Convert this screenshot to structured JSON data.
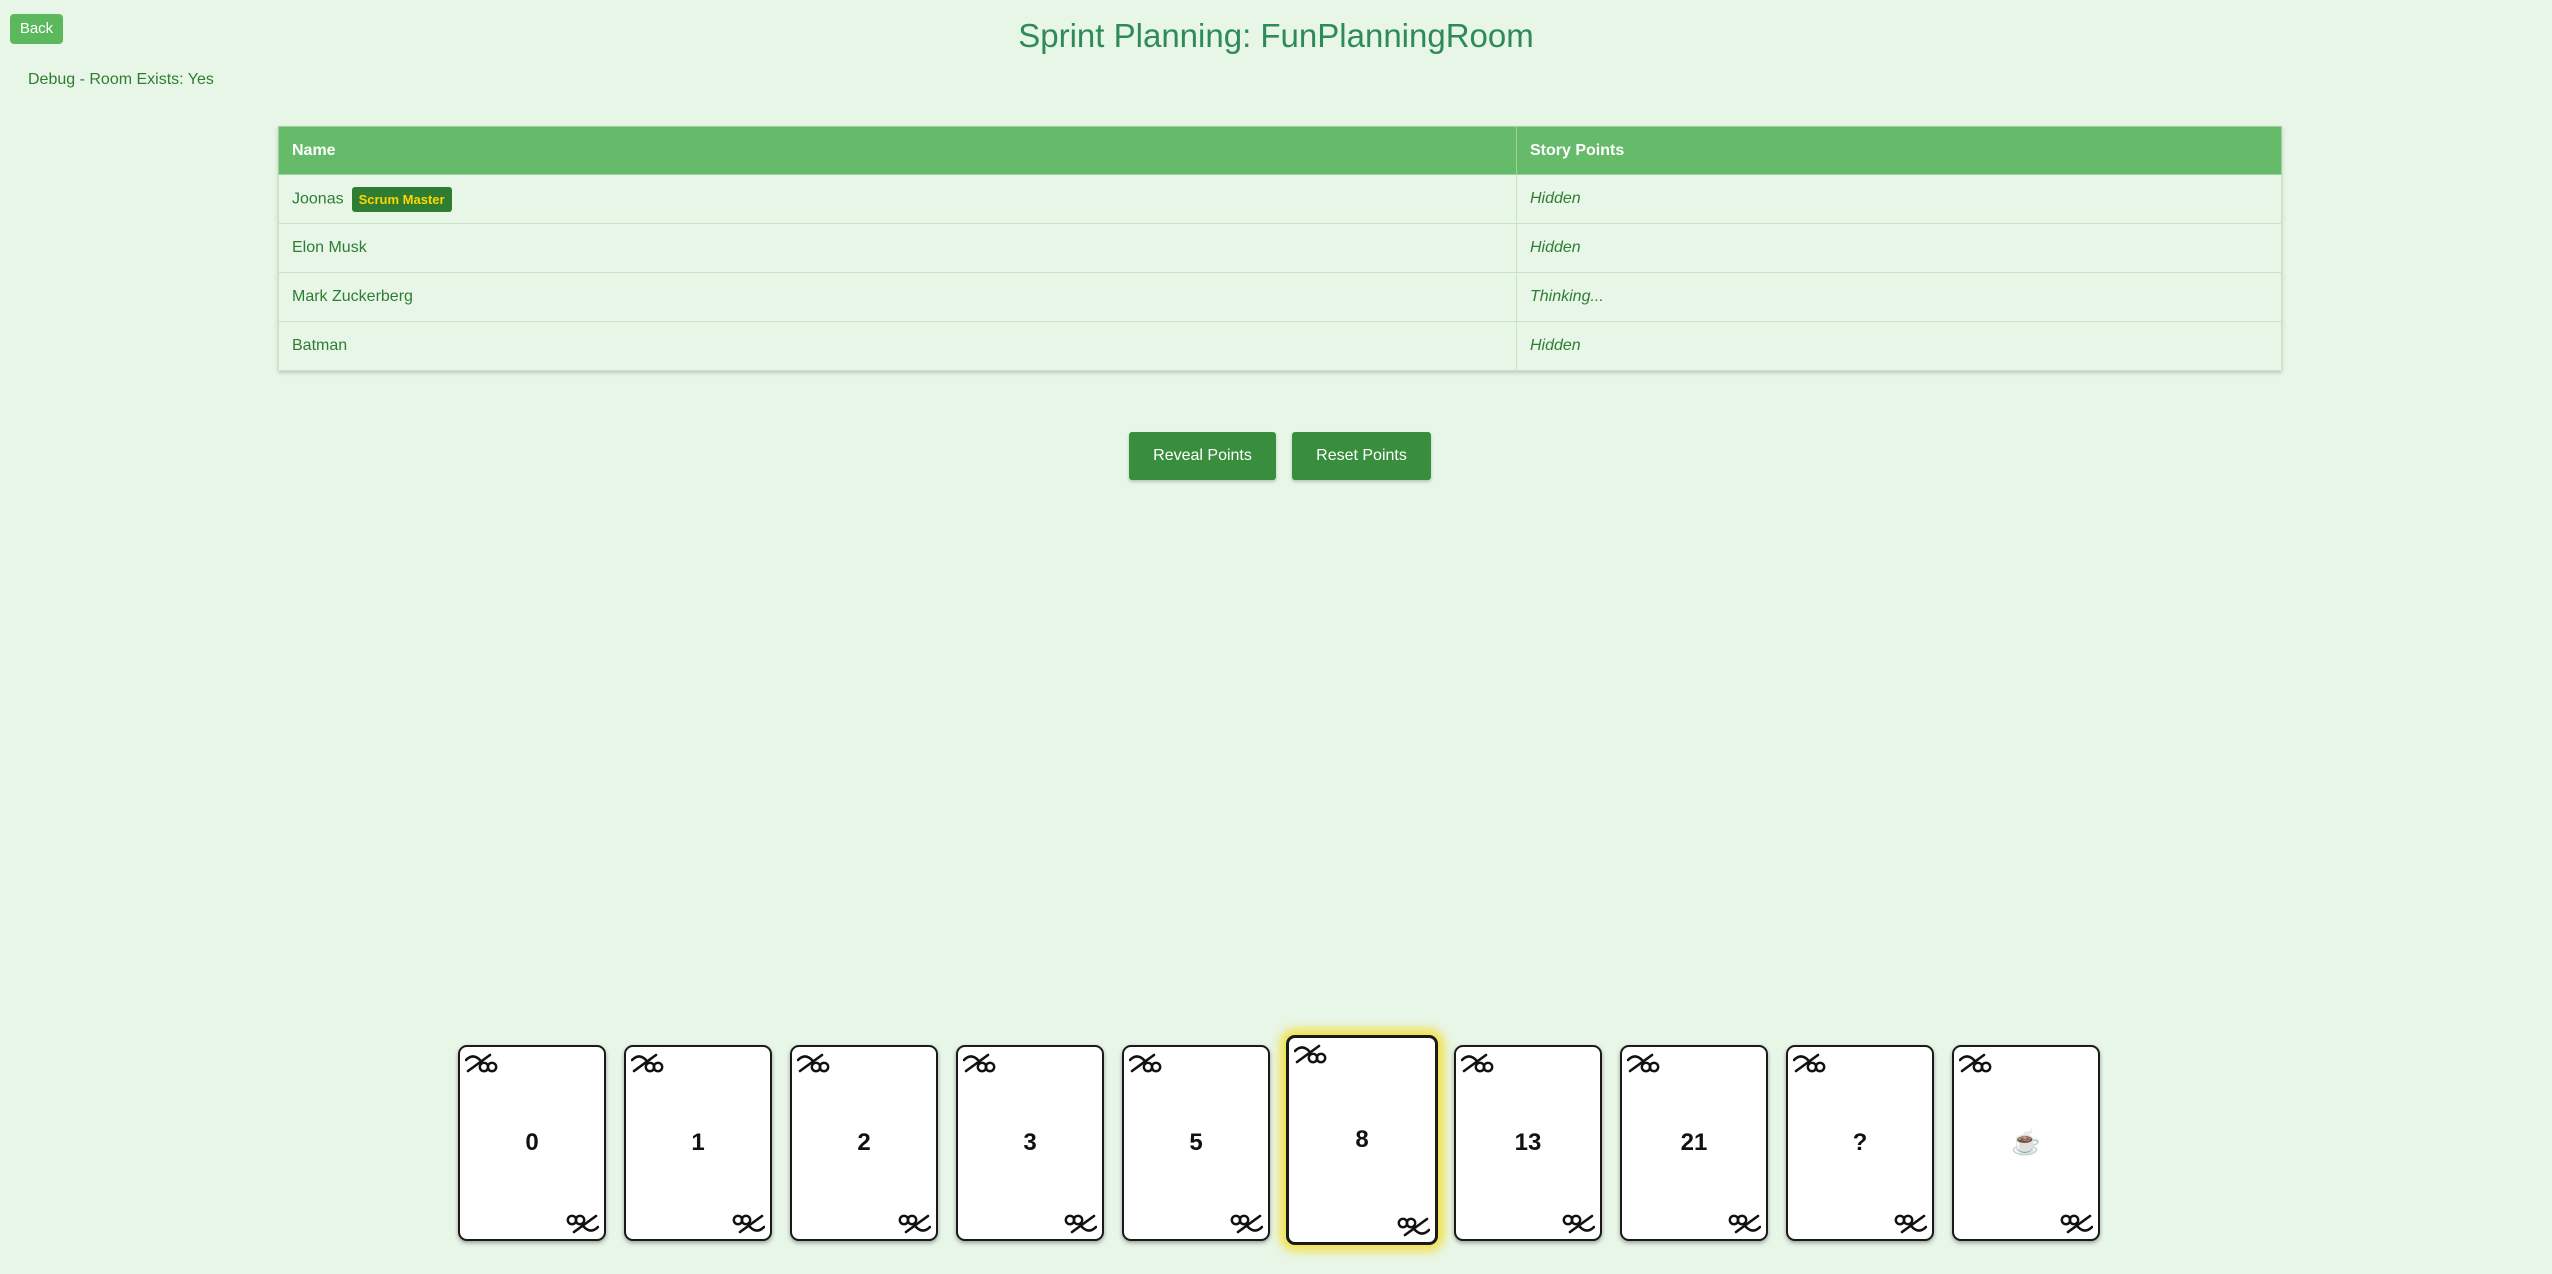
{
  "header": {
    "back_label": "Back",
    "title": "Sprint Planning: FunPlanningRoom",
    "debug": "Debug - Room Exists: Yes"
  },
  "table": {
    "columns": [
      "Name",
      "Story Points"
    ],
    "rows": [
      {
        "name": "Joonas",
        "badge": "Scrum Master",
        "points": "Hidden"
      },
      {
        "name": "Elon Musk",
        "points": "Hidden"
      },
      {
        "name": "Mark Zuckerberg",
        "points": "Thinking..."
      },
      {
        "name": "Batman",
        "points": "Hidden"
      }
    ]
  },
  "actions": {
    "reveal_label": "Reveal Points",
    "reset_label": "Reset Points"
  },
  "cards": [
    {
      "value": "0",
      "selected": false
    },
    {
      "value": "1",
      "selected": false
    },
    {
      "value": "2",
      "selected": false
    },
    {
      "value": "3",
      "selected": false
    },
    {
      "value": "5",
      "selected": false
    },
    {
      "value": "8",
      "selected": true
    },
    {
      "value": "13",
      "selected": false
    },
    {
      "value": "21",
      "selected": false
    },
    {
      "value": "?",
      "selected": false
    },
    {
      "value": "☕",
      "selected": false
    }
  ],
  "card_corner_icon": "card-swirl-icon",
  "colors": {
    "background": "#e8f6e8",
    "accent": "#5cb85c",
    "header_row": "#66bb6a",
    "button": "#388e3c",
    "title": "#2e8b57",
    "badge_bg": "#2e7d32",
    "badge_text": "#ffd600",
    "selected_glow": "#f5dc28"
  }
}
